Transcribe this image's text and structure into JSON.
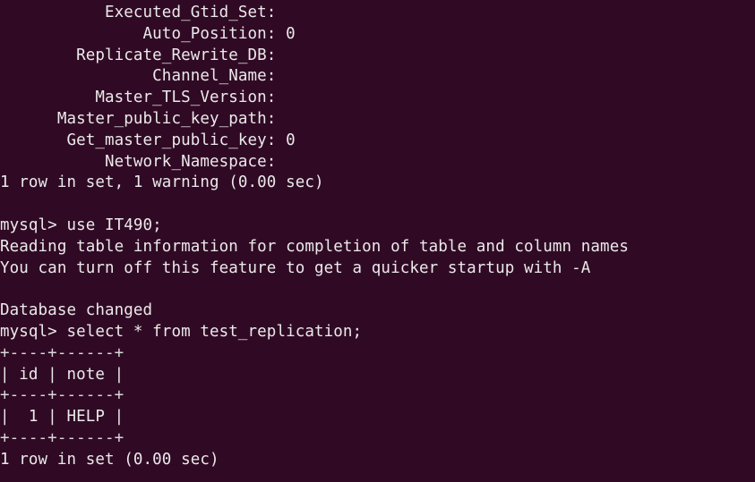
{
  "terminal": {
    "background": "#300a24",
    "foreground": "#ebe9eb",
    "lines": [
      "           Executed_Gtid_Set:",
      "               Auto_Position: 0",
      "        Replicate_Rewrite_DB:",
      "                Channel_Name:",
      "          Master_TLS_Version:",
      "      Master_public_key_path:",
      "       Get_master_public_key: 0",
      "           Network_Namespace:",
      "1 row in set, 1 warning (0.00 sec)",
      "",
      "mysql> use IT490;",
      "Reading table information for completion of table and column names",
      "You can turn off this feature to get a quicker startup with -A",
      "",
      "Database changed",
      "mysql> select * from test_replication;",
      "+----+------+",
      "| id | note |",
      "+----+------+",
      "|  1 | HELP |",
      "+----+------+",
      "1 row in set (0.00 sec)"
    ]
  }
}
